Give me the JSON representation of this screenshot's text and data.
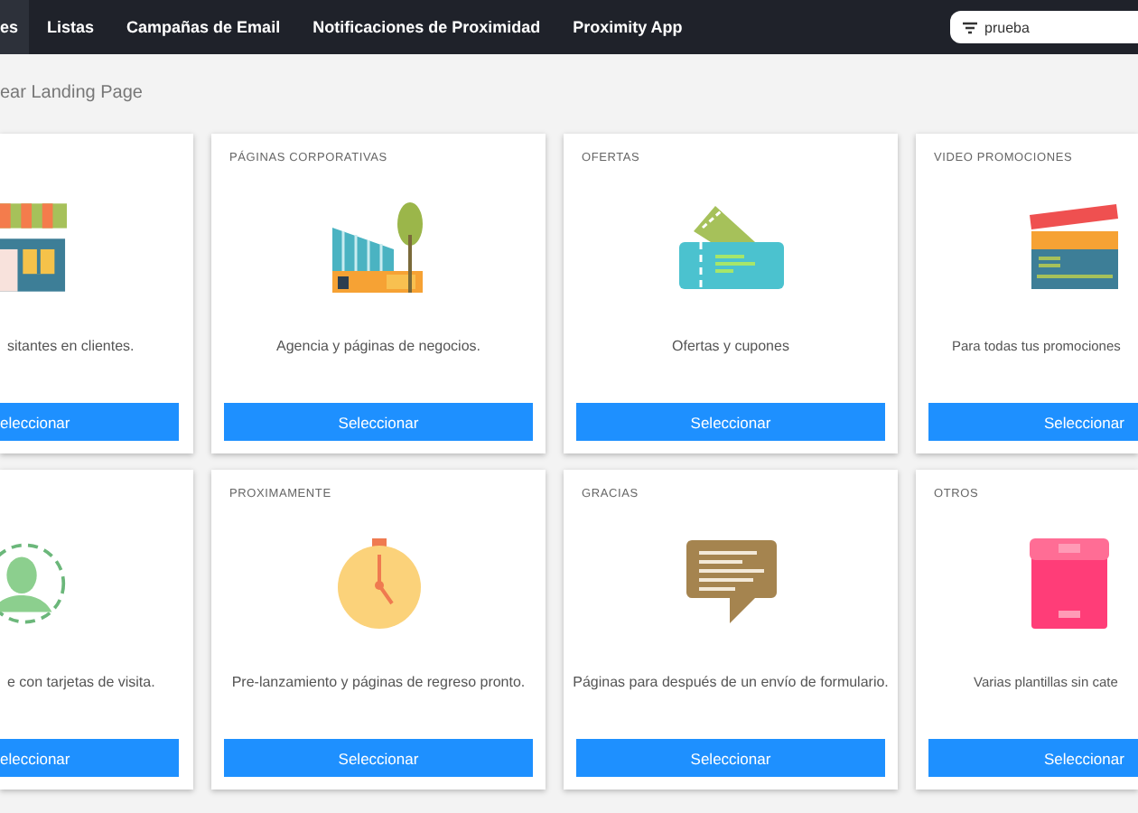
{
  "nav": {
    "items": [
      {
        "label": "es",
        "selected": true
      },
      {
        "label": "Listas",
        "selected": false
      },
      {
        "label": "Campañas de Email",
        "selected": false
      },
      {
        "label": "Notificaciones de Proximidad",
        "selected": false
      },
      {
        "label": "Proximity App",
        "selected": false
      }
    ],
    "project_select": {
      "value": "prueba"
    }
  },
  "heading": "ear Landing Page",
  "cards": [
    {
      "kind": "store",
      "description": "sitantes en clientes.",
      "button": "eleccionar"
    },
    {
      "kind": "building",
      "title": "PÁGINAS CORPORATIVAS",
      "description": "Agencia y páginas de negocios.",
      "button": "Seleccionar"
    },
    {
      "kind": "tickets",
      "title": "OFERTAS",
      "description": "Ofertas y cupones",
      "button": "Seleccionar"
    },
    {
      "kind": "clapperboard",
      "title": "VIDEO PROMOCIONES",
      "description": "Para todas tus promociones",
      "button": "Seleccionar"
    },
    {
      "kind": "person",
      "description": "e con tarjetas de visita.",
      "button": "eleccionar"
    },
    {
      "kind": "stopwatch",
      "title": "PROXIMAMENTE",
      "description": "Pre-lanzamiento y páginas de regreso pronto.",
      "button": "Seleccionar"
    },
    {
      "kind": "chat",
      "title": "GRACIAS",
      "description": "Páginas para después de un envío de formulario.",
      "button": "Seleccionar"
    },
    {
      "kind": "box",
      "title": "OTROS",
      "description": "Varias plantillas sin cate",
      "button": "Seleccionar"
    }
  ]
}
